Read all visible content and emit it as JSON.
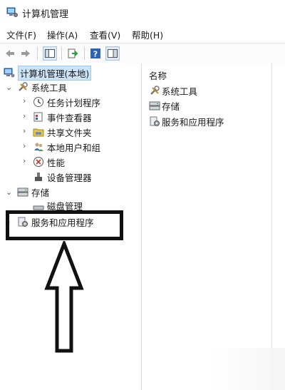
{
  "window": {
    "title": "计算机管理"
  },
  "menu": [
    {
      "label": "文件(F)"
    },
    {
      "label": "操作(A)"
    },
    {
      "label": "查看(V)"
    },
    {
      "label": "帮助(H)"
    }
  ],
  "toolbar": {
    "icons": [
      "back-arrow-icon",
      "forward-arrow-icon",
      "show-hide-tree-icon",
      "export-list-icon",
      "help-icon",
      "properties-pane-icon"
    ]
  },
  "tree": {
    "root": {
      "label": "计算机管理(本地)"
    },
    "system_tools": {
      "label": "系统工具",
      "children": [
        {
          "label": "任务计划程序"
        },
        {
          "label": "事件查看器"
        },
        {
          "label": "共享文件夹"
        },
        {
          "label": "本地用户和组"
        },
        {
          "label": "性能"
        },
        {
          "label": "设备管理器"
        }
      ]
    },
    "storage": {
      "label": "存储",
      "children": [
        {
          "label": "磁盘管理"
        }
      ]
    },
    "services": {
      "label": "服务和应用程序"
    }
  },
  "list": {
    "column_header": "名称",
    "items": [
      {
        "label": "系统工具"
      },
      {
        "label": "存储"
      },
      {
        "label": "服务和应用程序"
      }
    ]
  },
  "colors": {
    "selection_bg": "#cce4f7",
    "annotation": "#111111"
  }
}
